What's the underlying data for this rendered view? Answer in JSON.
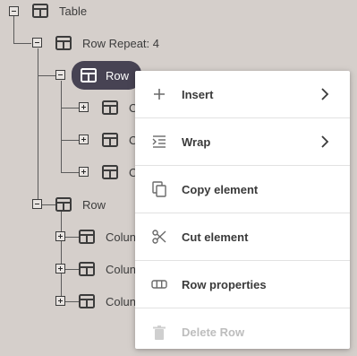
{
  "tree": {
    "table_label": "Table",
    "row_repeat_label": "Row Repeat: 4",
    "selected_row_label": "Row",
    "row_label": "Row",
    "child_label_a": "C",
    "child_label_b": "Colun"
  },
  "menu": {
    "insert": "Insert",
    "wrap": "Wrap",
    "copy": "Copy element",
    "cut": "Cut element",
    "properties": "Row properties",
    "delete": "Delete Row"
  },
  "colors": {
    "background": "#d5cfcb",
    "selected_node": "#474353",
    "disabled_text": "#bdbdbd"
  }
}
